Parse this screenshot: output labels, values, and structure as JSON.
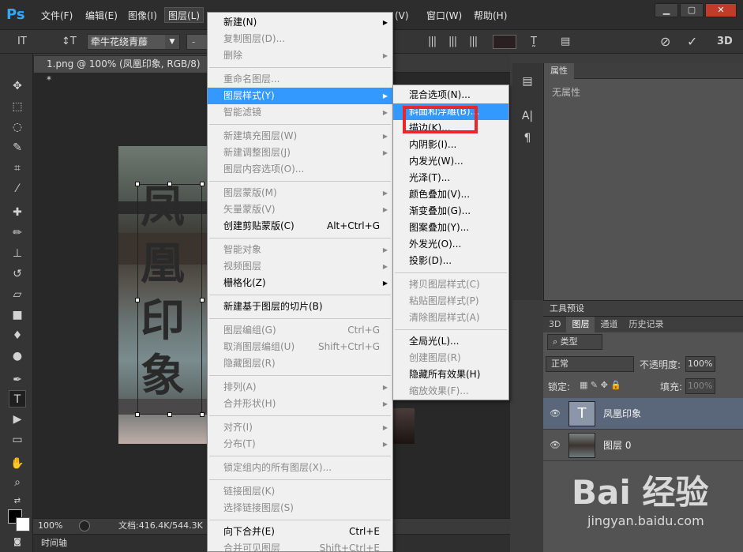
{
  "menubar": {
    "logo": "Ps",
    "items": [
      "文件(F)",
      "编辑(E)",
      "图像(I)",
      "图层(L)",
      "(V)",
      "窗口(W)",
      "帮助(H)"
    ],
    "win_buttons": [
      "▁",
      "▢",
      "✕"
    ]
  },
  "optbar": {
    "tool_icon": "IT",
    "orient_icon": "↕T",
    "font_name": "牵牛花绕青藤",
    "style_value": "-"
  },
  "document": {
    "tab_title": "1.png @ 100% (凤凰印象, RGB/8) *",
    "tab_close": "×",
    "canvas_text": [
      "凤",
      "凰",
      "印",
      "象"
    ]
  },
  "statusbar": {
    "zoom": "100%",
    "doc_info": "文档:416.4K/544.3K",
    "timeline": "时间轴"
  },
  "properties": {
    "title": "属性",
    "body": "无属性"
  },
  "tool_preset": "工具预设",
  "layers": {
    "tabs": [
      "3D",
      "图层",
      "通道",
      "历史记录"
    ],
    "filter_label": "类型",
    "blend_mode": "正常",
    "opacity_label": "不透明度:",
    "opacity_value": "100%",
    "lock_label": "锁定:",
    "fill_label": "填充:",
    "fill_value": "100%",
    "rows": [
      {
        "name": "凤凰印象",
        "thumb": "T"
      },
      {
        "name": "图层 0",
        "thumb": ""
      }
    ]
  },
  "layer_menu": {
    "items": [
      {
        "label": "新建(N)",
        "sub": true
      },
      {
        "label": "复制图层(D)...",
        "disabled": true
      },
      {
        "label": "删除",
        "sub": true,
        "disabled": true
      },
      {
        "sep": true
      },
      {
        "label": "重命名图层...",
        "disabled": true
      },
      {
        "label": "图层样式(Y)",
        "sub": true,
        "highlight": true
      },
      {
        "label": "智能滤镜",
        "sub": true,
        "disabled": true
      },
      {
        "sep": true
      },
      {
        "label": "新建填充图层(W)",
        "sub": true,
        "disabled": true
      },
      {
        "label": "新建调整图层(J)",
        "sub": true,
        "disabled": true
      },
      {
        "label": "图层内容选项(O)...",
        "disabled": true
      },
      {
        "sep": true
      },
      {
        "label": "图层蒙版(M)",
        "sub": true,
        "disabled": true
      },
      {
        "label": "矢量蒙版(V)",
        "sub": true,
        "disabled": true
      },
      {
        "label": "创建剪贴蒙版(C)",
        "shortcut": "Alt+Ctrl+G"
      },
      {
        "sep": true
      },
      {
        "label": "智能对象",
        "sub": true,
        "disabled": true
      },
      {
        "label": "视频图层",
        "sub": true,
        "disabled": true
      },
      {
        "label": "栅格化(Z)",
        "sub": true
      },
      {
        "sep": true
      },
      {
        "label": "新建基于图层的切片(B)"
      },
      {
        "sep": true
      },
      {
        "label": "图层编组(G)",
        "shortcut": "Ctrl+G",
        "disabled": true
      },
      {
        "label": "取消图层编组(U)",
        "shortcut": "Shift+Ctrl+G",
        "disabled": true
      },
      {
        "label": "隐藏图层(R)",
        "disabled": true
      },
      {
        "sep": true
      },
      {
        "label": "排列(A)",
        "sub": true,
        "disabled": true
      },
      {
        "label": "合并形状(H)",
        "sub": true,
        "disabled": true
      },
      {
        "sep": true
      },
      {
        "label": "对齐(I)",
        "sub": true,
        "disabled": true
      },
      {
        "label": "分布(T)",
        "sub": true,
        "disabled": true
      },
      {
        "sep": true
      },
      {
        "label": "锁定组内的所有图层(X)...",
        "disabled": true
      },
      {
        "sep": true
      },
      {
        "label": "链接图层(K)",
        "disabled": true
      },
      {
        "label": "选择链接图层(S)",
        "disabled": true
      },
      {
        "sep": true
      },
      {
        "label": "向下合并(E)",
        "shortcut": "Ctrl+E"
      },
      {
        "label": "合并可见图层",
        "shortcut": "Shift+Ctrl+E",
        "disabled": true
      }
    ]
  },
  "style_menu": {
    "items": [
      {
        "label": "混合选项(N)..."
      },
      {
        "label": "斜面和浮雕(B)...",
        "highlight": true
      },
      {
        "label": "描边(K)..."
      },
      {
        "label": "内阴影(I)..."
      },
      {
        "label": "内发光(W)..."
      },
      {
        "label": "光泽(T)..."
      },
      {
        "label": "颜色叠加(V)..."
      },
      {
        "label": "渐变叠加(G)..."
      },
      {
        "label": "图案叠加(Y)..."
      },
      {
        "label": "外发光(O)..."
      },
      {
        "label": "投影(D)..."
      },
      {
        "sep": true
      },
      {
        "label": "拷贝图层样式(C)",
        "disabled": true
      },
      {
        "label": "粘贴图层样式(P)",
        "disabled": true
      },
      {
        "label": "清除图层样式(A)",
        "disabled": true
      },
      {
        "sep": true
      },
      {
        "label": "全局光(L)..."
      },
      {
        "label": "创建图层(R)",
        "disabled": true
      },
      {
        "label": "隐藏所有效果(H)"
      },
      {
        "label": "缩放效果(F)...",
        "disabled": true
      }
    ]
  },
  "watermark": {
    "logo": "Bai 经验",
    "url": "jingyan.baidu.com"
  },
  "colors": {
    "menu_highlight": "#3399ff",
    "annotation_red": "#e8262c",
    "selected_layer": "#5a667a"
  }
}
